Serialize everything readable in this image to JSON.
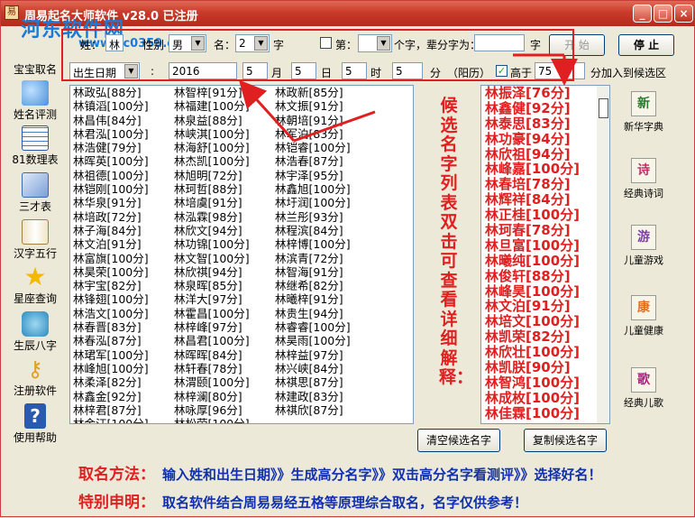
{
  "window": {
    "title": "周易起名大师软件 v28.0 已注册",
    "watermark": "河东软件网",
    "watermark_url": "www.pc0359.cn"
  },
  "top_form": {
    "surname_label": "姓：",
    "surname_value": "林",
    "gender_label": "性别",
    "gender_value": "男",
    "name_label": "名：",
    "name_count": "2",
    "name_count_unit": "字",
    "generation_checkbox_label": "第：",
    "generation_value": "",
    "generation_suffix": "个字，辈分字为：",
    "generation_char": "",
    "generation_unit": "字",
    "start_button": "开 始",
    "stop_button": "停 止",
    "birth_select": "出生日期",
    "year": "2016",
    "month": "5",
    "month_unit": "月",
    "day": "5",
    "day_unit": "日",
    "hour": "5",
    "hour_unit": "时",
    "minute": "5",
    "minute_unit": "分",
    "calendar_label": "（阳历）",
    "above_checkbox_label": "高于",
    "above_value": "75",
    "above_suffix": "分加入到候选区"
  },
  "left_nav": [
    {
      "label": "宝宝取名",
      "icon": "baby-name-icon"
    },
    {
      "label": "姓名评测",
      "icon": "people-icon"
    },
    {
      "label": "81数理表",
      "icon": "table-icon"
    },
    {
      "label": "三才表",
      "icon": "sheets-icon"
    },
    {
      "label": "汉字五行",
      "icon": "book-icon"
    },
    {
      "label": "星座查询",
      "icon": "star-icon"
    },
    {
      "label": "生辰八字",
      "icon": "shirt-icon"
    },
    {
      "label": "注册软件",
      "icon": "key-icon"
    },
    {
      "label": "使用帮助",
      "icon": "help-icon"
    }
  ],
  "name_list": {
    "columns": [
      [
        "林政弘[88分]",
        "林镇滔[100分]",
        "林昌伟[84分]",
        "林君泓[100分]",
        "林浩健[79分]",
        "林晖英[100分]",
        "林祖德[100分]",
        "林铠刚[100分]",
        "林华泉[91分]",
        "林培政[72分]",
        "林子海[84分]",
        "林文泊[91分]",
        "林富旗[100分]",
        "林昊荣[100分]",
        "林宇宝[82分]",
        "林锋翅[100分]",
        "林浩文[100分]",
        "林春晋[83分]",
        "林春泓[87分]",
        "林珺军[100分]",
        "林峰旭[100分]",
        "林柔泽[82分]",
        "林鑫金[92分]",
        "林梓君[87分]",
        "林金汪[100分]",
        "林铮铠[100分]"
      ],
      [
        "林智梓[91分]",
        "林福建[100分]",
        "林泉益[88分]",
        "林峡淇[100分]",
        "林海舒[100分]",
        "林杰凯[100分]",
        "林旭明[72分]",
        "林珂哲[88分]",
        "林培虞[91分]",
        "林泓霖[98分]",
        "林欣文[94分]",
        "林功锦[100分]",
        "林文智[100分]",
        "林欣祺[94分]",
        "林泉晖[85分]",
        "林洋大[97分]",
        "林霍昌[100分]",
        "林梓峰[97分]",
        "林昌君[100分]",
        "林晖晖[84分]",
        "林轩春[78分]",
        "林渭颐[100分]",
        "林梓澜[80分]",
        "林咏厚[96分]",
        "林松荣[100分]"
      ],
      [
        "林政新[85分]",
        "林文振[91分]",
        "林朝培[91分]",
        "林军泊[83分]",
        "林铠睿[100分]",
        "林浩春[87分]",
        "林宇泽[95分]",
        "林鑫旭[100分]",
        "林圩润[100分]",
        "林兰彤[93分]",
        "林程滨[84分]",
        "林梓博[100分]",
        "林滨青[72分]",
        "林智海[91分]",
        "林继希[82分]",
        "林曦梓[91分]",
        "林贵生[94分]",
        "林睿睿[100分]",
        "林昊雨[100分]",
        "林梓益[97分]",
        "林兴峡[84分]",
        "林祺思[87分]",
        "林建政[83分]",
        "林祺欣[87分]"
      ]
    ]
  },
  "vertical_hint": "候选名字列表双击可查看详细解释：",
  "candidates": [
    "林振泽[76分]",
    "林鑫健[92分]",
    "林泰思[83分]",
    "林功豪[94分]",
    "林欣祖[94分]",
    "林峰嘉[100分]",
    "林春培[78分]",
    "林辉祥[84分]",
    "林正桂[100分]",
    "林珂春[78分]",
    "林旦富[100分]",
    "林曦纯[100分]",
    "林俊轩[88分]",
    "林峰昊[100分]",
    "林文泊[91分]",
    "林培文[100分]",
    "林凯荣[82分]",
    "林欣壮[100分]",
    "林凯朕[90分]",
    "林智鸿[100分]",
    "林成枚[100分]",
    "林佳霖[100分]"
  ],
  "buttons": {
    "clear_candidates": "清空候选名字",
    "copy_candidates": "复制候选名字"
  },
  "right_nav": [
    {
      "label": "新华字典",
      "glyph": "新",
      "color": "#2a7a30"
    },
    {
      "label": "经典诗词",
      "glyph": "诗",
      "color": "#c0306a"
    },
    {
      "label": "儿童游戏",
      "glyph": "游",
      "color": "#8040b0"
    },
    {
      "label": "儿童健康",
      "glyph": "康",
      "color": "#e07020"
    },
    {
      "label": "经典儿歌",
      "glyph": "歌",
      "color": "#b02080"
    }
  ],
  "footer": {
    "method_heading": "取名方法：",
    "method_text": "输入姓和出生日期》》生成高分名字》》双击高分名字看测评》》选择好名！",
    "note_heading": "特别申明：",
    "note_text": "取名软件结合周易易经五格等原理综合取名，名字仅供参考！"
  },
  "colors": {
    "title_bar": "#c93a2a",
    "accent_red": "#e02020",
    "footer_blue": "#1030b0",
    "background": "#ece9d8"
  }
}
